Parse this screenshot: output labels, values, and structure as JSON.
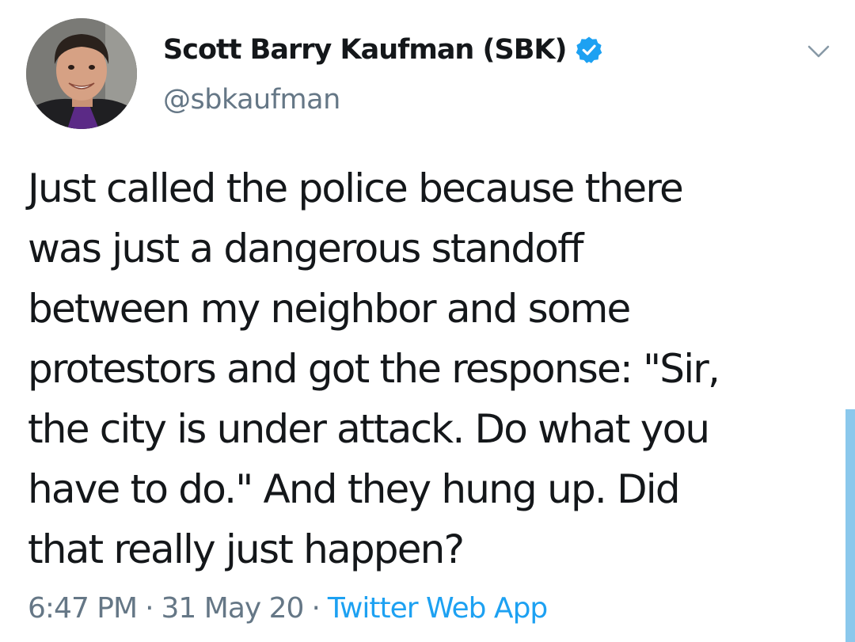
{
  "author": {
    "display_name": "Scott Barry Kaufman (SBK)",
    "handle": "@sbkaufman",
    "verified": true,
    "avatar_icon": "profile-photo"
  },
  "tweet": {
    "text": "Just called the police because there\nwas just a dangerous standoff\nbetween my neighbor and some\nprotestors and got the response: \"Sir,\nthe city is under attack. Do what you\nhave to do.\" And they hung up. Did\nthat really just happen?",
    "time": "6:47 PM",
    "date": "31 May 20",
    "separator": "·",
    "source": "Twitter Web App"
  },
  "icons": {
    "verified": "verified-badge-icon",
    "menu": "chevron-down-icon"
  },
  "colors": {
    "text": "#14171a",
    "secondary": "#657786",
    "accent": "#1da1f2",
    "scroll_indicator": "#8bc8ec"
  }
}
